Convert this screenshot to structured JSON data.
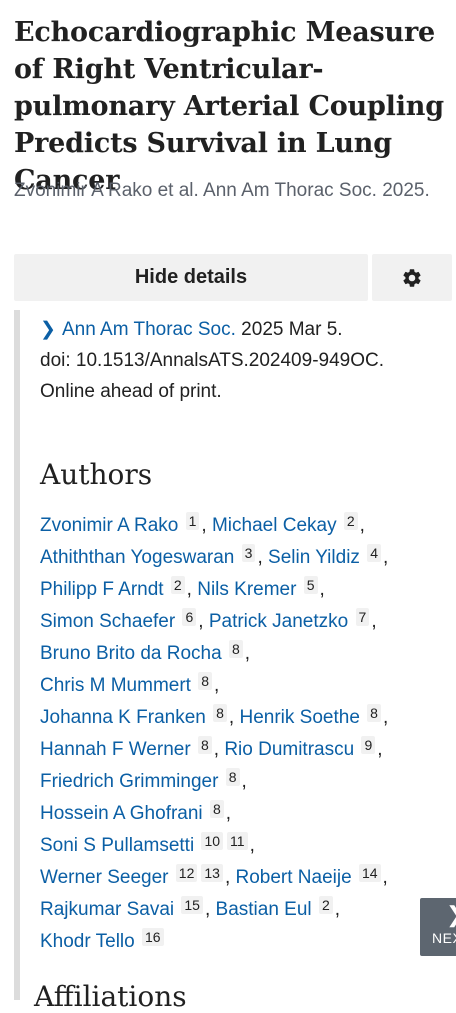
{
  "article": {
    "title": "Echocardiographic Measure of Right Ventricular-pulmonary Arterial Coupling Predicts Survival in Lung Cancer",
    "citation": "Zvonimir A Rako et al. Ann Am Thorac Soc. 2025."
  },
  "controls": {
    "hide_details_label": "Hide details",
    "settings_icon": "gear-icon"
  },
  "details": {
    "journal_link": "Ann Am Thorac Soc.",
    "date": " 2025 Mar 5.",
    "doi": "doi: 10.1513/AnnalsATS.202409-949OC.",
    "status": "Online ahead of print."
  },
  "authors_heading": "Authors",
  "authors": [
    {
      "name": "Zvonimir A Rako",
      "affs": [
        "1"
      ]
    },
    {
      "name": "Michael Cekay",
      "affs": [
        "2"
      ]
    },
    {
      "name": "Athiththan Yogeswaran",
      "affs": [
        "3"
      ]
    },
    {
      "name": "Selin Yildiz",
      "affs": [
        "4"
      ]
    },
    {
      "name": "Philipp F Arndt",
      "affs": [
        "2"
      ]
    },
    {
      "name": "Nils Kremer",
      "affs": [
        "5"
      ]
    },
    {
      "name": "Simon Schaefer",
      "affs": [
        "6"
      ]
    },
    {
      "name": "Patrick Janetzko",
      "affs": [
        "7"
      ]
    },
    {
      "name": "Bruno Brito da Rocha",
      "affs": [
        "8"
      ]
    },
    {
      "name": "Chris M Mummert",
      "affs": [
        "8"
      ]
    },
    {
      "name": "Johanna K Franken",
      "affs": [
        "8"
      ]
    },
    {
      "name": "Henrik Soethe",
      "affs": [
        "8"
      ]
    },
    {
      "name": "Hannah F Werner",
      "affs": [
        "8"
      ]
    },
    {
      "name": "Rio Dumitrascu",
      "affs": [
        "9"
      ]
    },
    {
      "name": "Friedrich Grimminger",
      "affs": [
        "8"
      ]
    },
    {
      "name": "Hossein A Ghofrani",
      "affs": [
        "8"
      ]
    },
    {
      "name": "Soni S Pullamsetti",
      "affs": [
        "10",
        "11"
      ]
    },
    {
      "name": "Werner Seeger",
      "affs": [
        "12",
        "13"
      ]
    },
    {
      "name": "Robert Naeije",
      "affs": [
        "14"
      ]
    },
    {
      "name": "Rajkumar Savai",
      "affs": [
        "15"
      ]
    },
    {
      "name": "Bastian Eul",
      "affs": [
        "2"
      ]
    },
    {
      "name": "Khodr Tello",
      "affs": [
        "16"
      ]
    }
  ],
  "next_button_label": "NEXT",
  "affiliations_heading": "Affiliations",
  "colors": {
    "link": "#0b5fa5",
    "text": "#212121",
    "muted": "#5b616b",
    "button_bg": "#f1f1f1",
    "next_bg": "#5d6670"
  }
}
